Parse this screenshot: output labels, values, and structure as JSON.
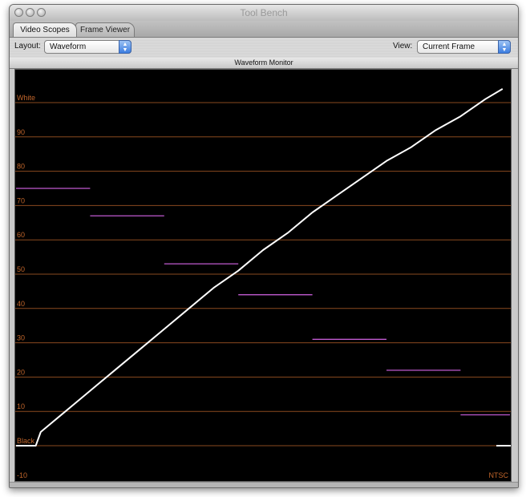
{
  "window": {
    "title": "Tool Bench"
  },
  "tabs": [
    {
      "label": "Video Scopes",
      "active": true
    },
    {
      "label": "Frame Viewer",
      "active": false
    }
  ],
  "controls": {
    "layout_label": "Layout:",
    "layout_value": "Waveform",
    "view_label": "View:",
    "view_value": "Current Frame"
  },
  "panel": {
    "title": "Waveform Monitor"
  },
  "scope": {
    "tick_labels": [
      "White",
      "90",
      "80",
      "70",
      "60",
      "50",
      "40",
      "30",
      "20",
      "10",
      "Black",
      "-10"
    ],
    "ticks_ire": [
      100,
      90,
      80,
      70,
      60,
      50,
      40,
      30,
      20,
      10,
      0,
      -10
    ],
    "standard": "NTSC",
    "colors": {
      "background": "#000000",
      "graticule": "#8a4a1f",
      "label": "#c2662b",
      "trace": "#ffffff",
      "marker": "#c05ad0"
    },
    "trace_ire": [
      [
        0,
        0
      ],
      [
        0.04,
        0
      ],
      [
        0.05,
        4
      ],
      [
        0.1,
        10
      ],
      [
        0.15,
        16
      ],
      [
        0.2,
        22
      ],
      [
        0.25,
        28
      ],
      [
        0.3,
        34
      ],
      [
        0.35,
        40
      ],
      [
        0.4,
        46
      ],
      [
        0.45,
        51
      ],
      [
        0.5,
        57
      ],
      [
        0.55,
        62
      ],
      [
        0.6,
        68
      ],
      [
        0.65,
        73
      ],
      [
        0.7,
        78
      ],
      [
        0.75,
        83
      ],
      [
        0.8,
        87
      ],
      [
        0.85,
        92
      ],
      [
        0.9,
        96
      ],
      [
        0.95,
        101
      ],
      [
        0.985,
        104
      ]
    ],
    "markers": [
      {
        "x": [
          0.0,
          0.15
        ],
        "ire": 75
      },
      {
        "x": [
          0.15,
          0.3
        ],
        "ire": 67
      },
      {
        "x": [
          0.3,
          0.45
        ],
        "ire": 53
      },
      {
        "x": [
          0.45,
          0.6
        ],
        "ire": 44
      },
      {
        "x": [
          0.6,
          0.75
        ],
        "ire": 31
      },
      {
        "x": [
          0.75,
          0.9
        ],
        "ire": 22
      },
      {
        "x": [
          0.9,
          1.0
        ],
        "ire": 9
      }
    ]
  }
}
